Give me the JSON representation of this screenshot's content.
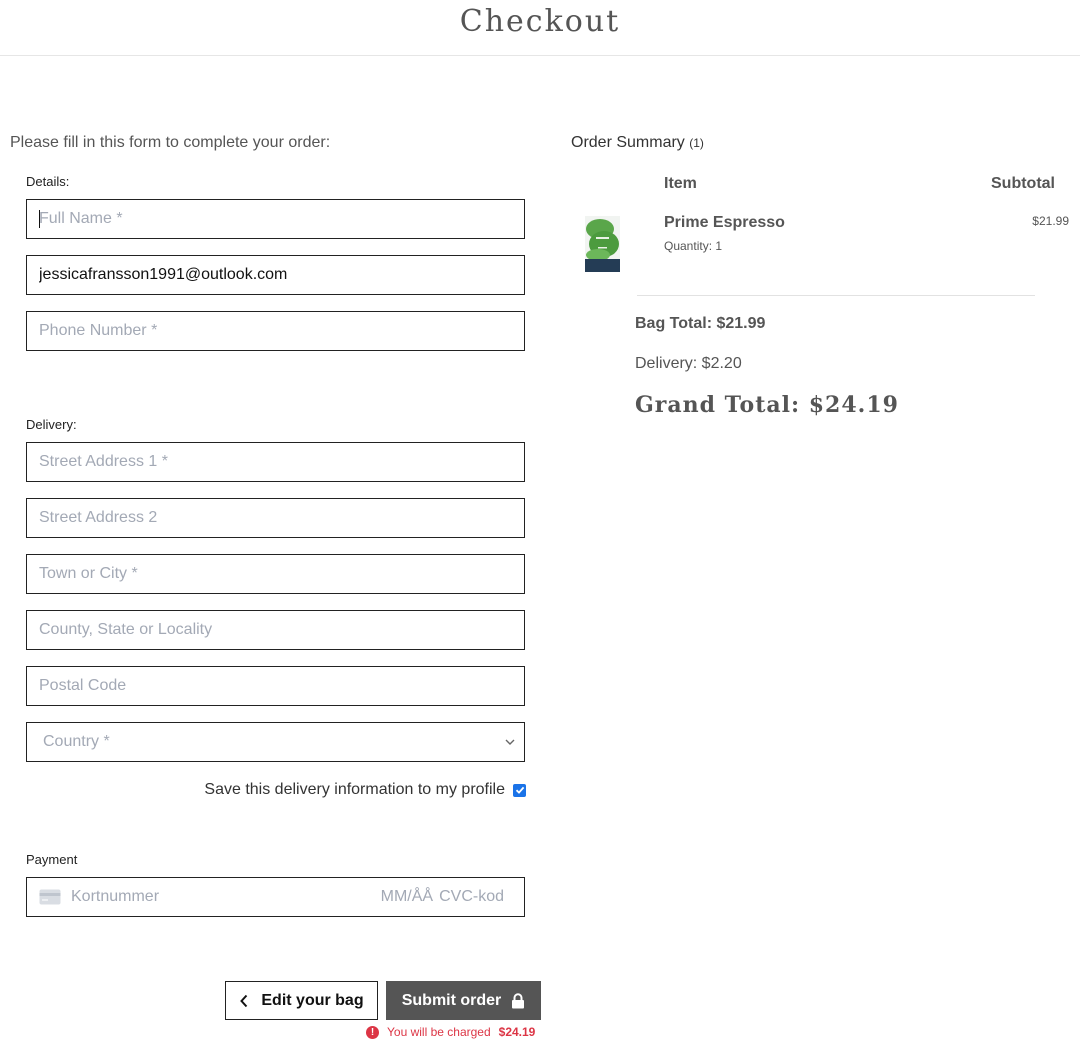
{
  "header": {
    "title": "Checkout"
  },
  "form": {
    "intro": "Please fill in this form to complete your order:",
    "details_label": "Details:",
    "full_name": {
      "placeholder": "Full Name *",
      "value": ""
    },
    "email": {
      "value": "jessicafransson1991@outlook.com"
    },
    "phone": {
      "placeholder": "Phone Number *",
      "value": ""
    },
    "delivery_label": "Delivery:",
    "street1": {
      "placeholder": "Street Address 1 *"
    },
    "street2": {
      "placeholder": "Street Address 2"
    },
    "town": {
      "placeholder": "Town or City *"
    },
    "county": {
      "placeholder": "County, State or Locality"
    },
    "postcode": {
      "placeholder": "Postal Code"
    },
    "country": {
      "selected": "Country *"
    },
    "save_label": "Save this delivery information to my profile",
    "save_checked": true,
    "payment_label": "Payment",
    "card": {
      "number_placeholder": "Kortnummer",
      "expiry_placeholder": "MM/ÅÅ",
      "cvc_placeholder": "CVC-kod"
    }
  },
  "actions": {
    "back_label": "Edit your bag",
    "submit_label": "Submit order",
    "charge_text": "You will be charged",
    "charge_amount": "$24.19"
  },
  "summary": {
    "title": "Order Summary",
    "count": "(1)",
    "col_item": "Item",
    "col_subtotal": "Subtotal",
    "items": [
      {
        "name": "Prime Espresso",
        "quantity": "Quantity: 1",
        "subtotal": "$21.99"
      }
    ],
    "bag_total": "Bag Total: $21.99",
    "delivery": "Delivery: $2.20",
    "grand_total": "Grand Total: $24.19"
  },
  "colors": {
    "accent_dark": "#555555",
    "error": "#dc3545",
    "checkbox": "#1a73e8",
    "placeholder": "#a3a9b5"
  }
}
